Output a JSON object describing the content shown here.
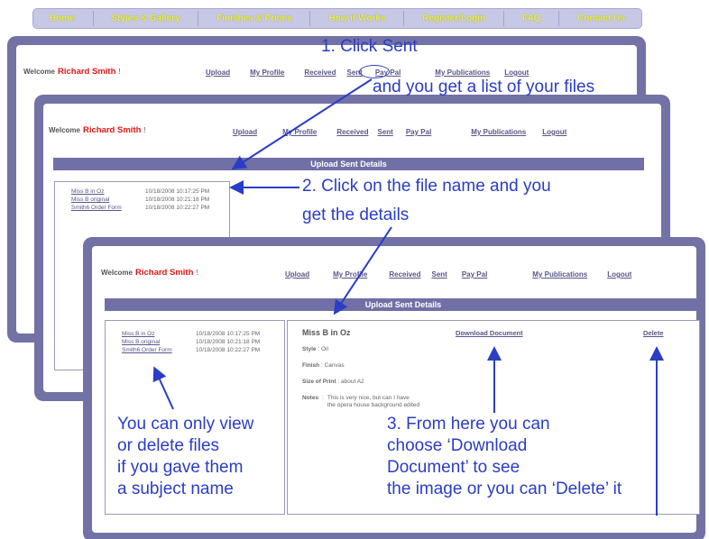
{
  "nav": [
    "Home",
    "Styles & Gallery",
    "Finishes & Prices",
    "How it Works",
    "Register/Login",
    "FAQ",
    "Contact Us"
  ],
  "welcome_label": "Welcome",
  "user_name": "Richard Smith",
  "user_suffix": "!",
  "menu": {
    "upload": "Upload",
    "my_profile": "My Profile",
    "received": "Received",
    "sent": "Sent",
    "pay_pal": "Pay Pal",
    "my_publications": "My Publications",
    "logout": "Logout"
  },
  "section_title": "Upload Sent Details",
  "files": [
    {
      "name": "Miss B in Oz",
      "date": "10/18/2008 10:17:25 PM"
    },
    {
      "name": "Miss B original",
      "date": "10/18/2008 10:21:18 PM"
    },
    {
      "name": "Smith6 Order Form",
      "date": "10/18/2008 10:22:27 PM"
    }
  ],
  "detail": {
    "title": "Miss B in Oz",
    "download_label": "Download Document",
    "delete_label": "Delete",
    "style_label": "Style",
    "style_value": "Oil",
    "finish_label": "Finish",
    "finish_value": "Canvas",
    "size_label": "Size of Print",
    "size_value": "about A2",
    "notes_label": "Notes",
    "notes_line1": "This is very nice, but can I have",
    "notes_line2": "the opera house background edited"
  },
  "annotations": {
    "step1_line1": "1. Click Sent",
    "step1_line2": "and you get a list of your files",
    "step2_line1": "2. Click on the file name and you",
    "step2_line2": "get the details",
    "view_line1": "You can only view",
    "view_line2": "or delete files",
    "view_line3": "if you gave them",
    "view_line4": "a subject name",
    "step3_line1": "3. From here you can",
    "step3_line2": "choose ‘Download",
    "step3_line3": "Document’ to see",
    "step3_line4": "the image or you can ‘Delete’ it"
  }
}
